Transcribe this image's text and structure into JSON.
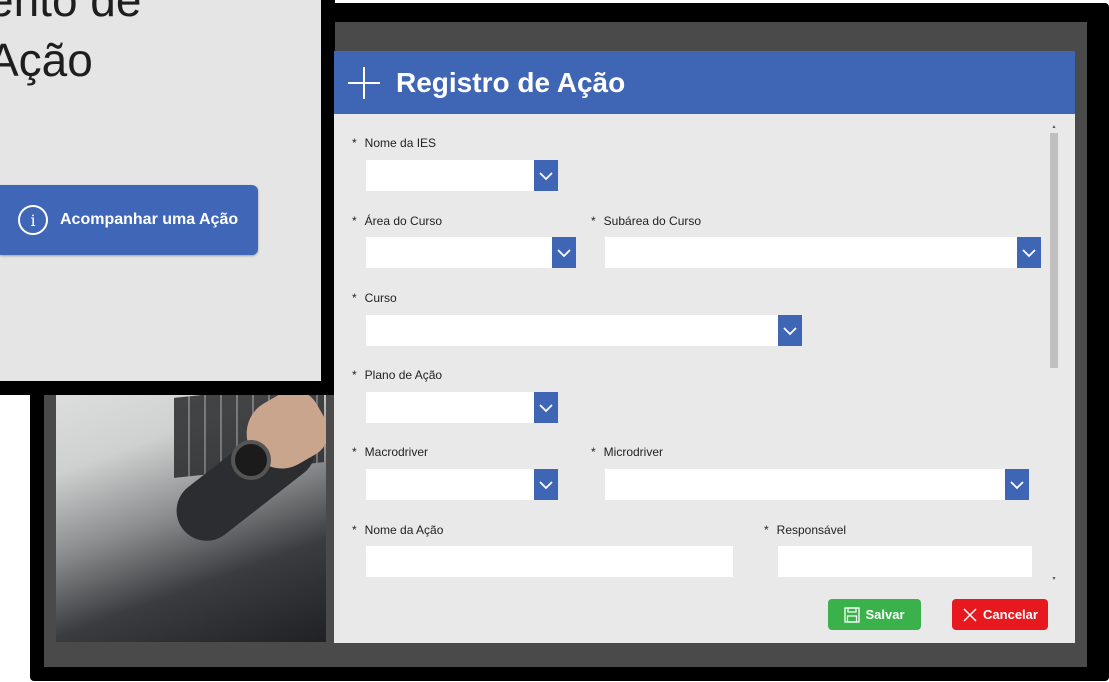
{
  "background_panel": {
    "heading_line1": "ento de",
    "heading_line2": "Ação",
    "track_button_label": "Acompanhar uma Ação",
    "info_icon_glyph": "i"
  },
  "form": {
    "title": "Registro de Ação",
    "required_mark": "*",
    "fields": {
      "nome_ies": {
        "label": "Nome da IES",
        "type": "dropdown",
        "value": ""
      },
      "area_curso": {
        "label": "Área do Curso",
        "type": "dropdown",
        "value": ""
      },
      "subarea_curso": {
        "label": "Subárea do Curso",
        "type": "dropdown",
        "value": ""
      },
      "curso": {
        "label": "Curso",
        "type": "dropdown",
        "value": ""
      },
      "plano_acao": {
        "label": "Plano de Ação",
        "type": "dropdown",
        "value": ""
      },
      "macrodriver": {
        "label": "Macrodriver",
        "type": "dropdown",
        "value": ""
      },
      "microdriver": {
        "label": "Microdriver",
        "type": "dropdown",
        "value": ""
      },
      "nome_acao": {
        "label": "Nome da Ação",
        "type": "text",
        "value": ""
      },
      "responsavel": {
        "label": "Responsável",
        "type": "text",
        "value": ""
      }
    },
    "buttons": {
      "save": "Salvar",
      "cancel": "Cancelar"
    }
  },
  "colors": {
    "header_blue": "#3f65b5",
    "save_green": "#3ab14a",
    "cancel_red": "#e8191e",
    "form_bg": "#e9e9e9"
  }
}
